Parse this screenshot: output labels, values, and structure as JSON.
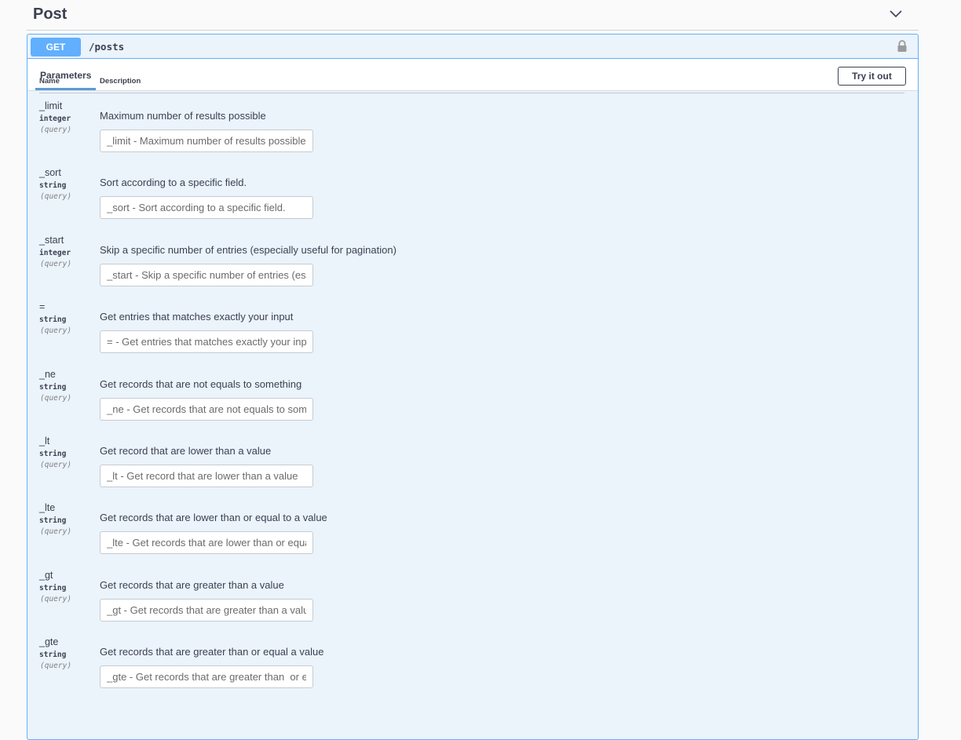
{
  "tag": {
    "title": "Post"
  },
  "operation": {
    "method": "GET",
    "path": "/posts",
    "tab_label": "Parameters",
    "try_button": "Try it out"
  },
  "table": {
    "headers": {
      "name": "Name",
      "description": "Description"
    },
    "params": [
      {
        "name": "_limit",
        "type": "integer",
        "in": "(query)",
        "description": "Maximum number of results possible",
        "placeholder": "_limit - Maximum number of results possible"
      },
      {
        "name": "_sort",
        "type": "string",
        "in": "(query)",
        "description": "Sort according to a specific field.",
        "placeholder": "_sort - Sort according to a specific field."
      },
      {
        "name": "_start",
        "type": "integer",
        "in": "(query)",
        "description": "Skip a specific number of entries (especially useful for pagination)",
        "placeholder": "_start - Skip a specific number of entries (especially useful for pagination)"
      },
      {
        "name": "=",
        "type": "string",
        "in": "(query)",
        "description": "Get entries that matches exactly your input",
        "placeholder": "= - Get entries that matches exactly your input"
      },
      {
        "name": "_ne",
        "type": "string",
        "in": "(query)",
        "description": "Get records that are not equals to something",
        "placeholder": "_ne - Get records that are not equals to something"
      },
      {
        "name": "_lt",
        "type": "string",
        "in": "(query)",
        "description": "Get record that are lower than a value",
        "placeholder": "_lt - Get record that are lower than a value"
      },
      {
        "name": "_lte",
        "type": "string",
        "in": "(query)",
        "description": "Get records that are lower than or equal to a value",
        "placeholder": "_lte - Get records that are lower than or equal to a value"
      },
      {
        "name": "_gt",
        "type": "string",
        "in": "(query)",
        "description": "Get records that are greater than a value",
        "placeholder": "_gt - Get records that are greater than a value"
      },
      {
        "name": "_gte",
        "type": "string",
        "in": "(query)",
        "description": "Get records that are greater than  or equal a value",
        "placeholder": "_gte - Get records that are greater than  or equal a value"
      }
    ]
  },
  "icons": {
    "toggle": "chevron-down-icon",
    "lock": "lock-icon"
  },
  "colors": {
    "get_accent": "#61affe",
    "get_background": "#ebf3fb"
  }
}
